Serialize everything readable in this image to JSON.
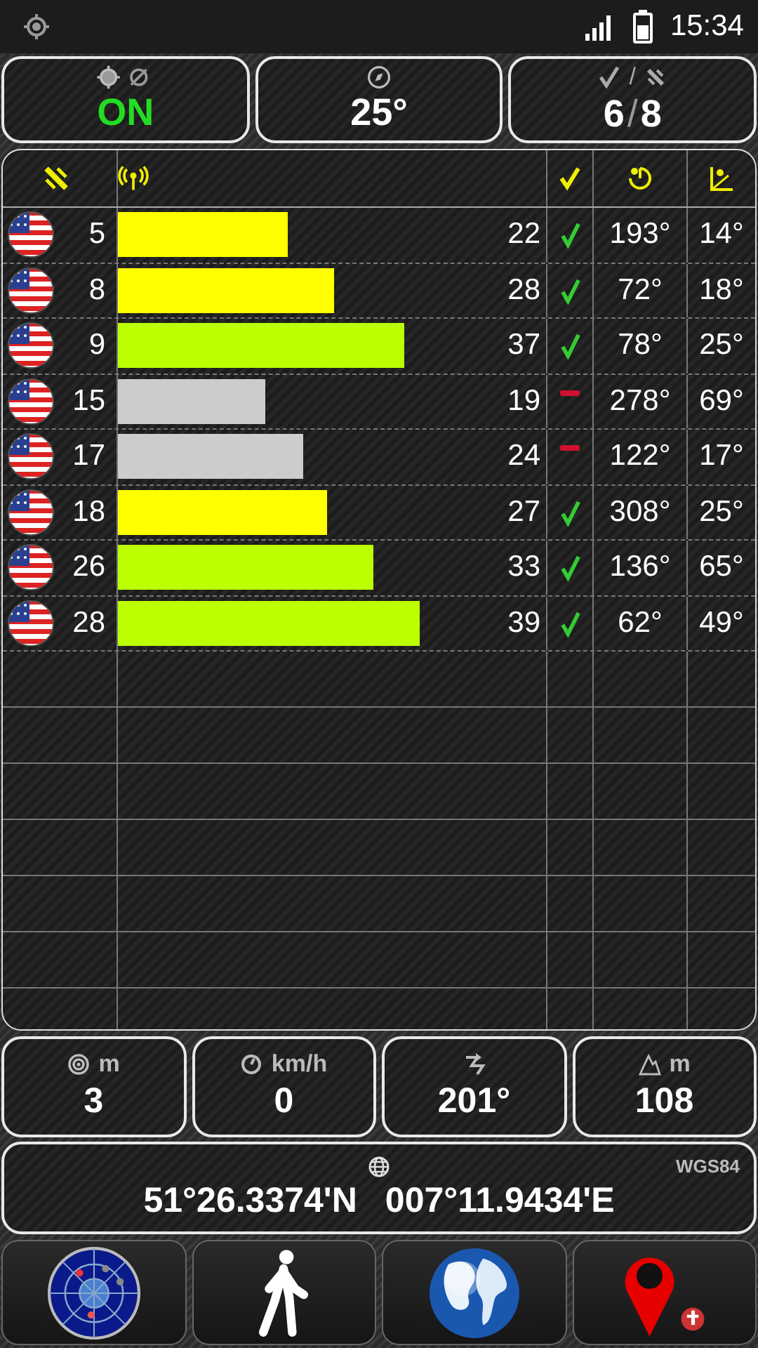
{
  "status_bar": {
    "time": "15:34"
  },
  "summary": {
    "fix": {
      "value": "ON",
      "on": true
    },
    "bearing": {
      "value": "25°"
    },
    "satellites": {
      "used": "6",
      "separator": "/",
      "total": "8",
      "icon_separator": "/"
    }
  },
  "satellites": [
    {
      "prn": "5",
      "snr": "22",
      "color": "#ffff00",
      "used": true,
      "azimuth": "193°",
      "elevation": "14°"
    },
    {
      "prn": "8",
      "snr": "28",
      "color": "#ffff00",
      "used": true,
      "azimuth": "72°",
      "elevation": "18°"
    },
    {
      "prn": "9",
      "snr": "37",
      "color": "#bbff00",
      "used": true,
      "azimuth": "78°",
      "elevation": "25°"
    },
    {
      "prn": "15",
      "snr": "19",
      "color": "#cccccc",
      "used": false,
      "azimuth": "278°",
      "elevation": "69°"
    },
    {
      "prn": "17",
      "snr": "24",
      "color": "#cccccc",
      "used": false,
      "azimuth": "122°",
      "elevation": "17°"
    },
    {
      "prn": "18",
      "snr": "27",
      "color": "#ffff00",
      "used": true,
      "azimuth": "308°",
      "elevation": "25°"
    },
    {
      "prn": "26",
      "snr": "33",
      "color": "#bbff00",
      "used": true,
      "azimuth": "136°",
      "elevation": "65°"
    },
    {
      "prn": "28",
      "snr": "39",
      "color": "#bbff00",
      "used": true,
      "azimuth": "62°",
      "elevation": "49°"
    }
  ],
  "readings": [
    {
      "kind": "accuracy",
      "unit": "m",
      "value": "3"
    },
    {
      "kind": "speed",
      "unit": "km/h",
      "value": "0"
    },
    {
      "kind": "heading",
      "value": "201°"
    },
    {
      "kind": "altitude",
      "unit": "m",
      "value": "108"
    }
  ],
  "position": {
    "datum": "WGS84",
    "latitude": "51°26.3374'N",
    "longitude": "007°11.9434'E"
  },
  "nav": [
    {
      "kind": "radar"
    },
    {
      "kind": "walk"
    },
    {
      "kind": "globe"
    },
    {
      "kind": "pin"
    }
  ]
}
